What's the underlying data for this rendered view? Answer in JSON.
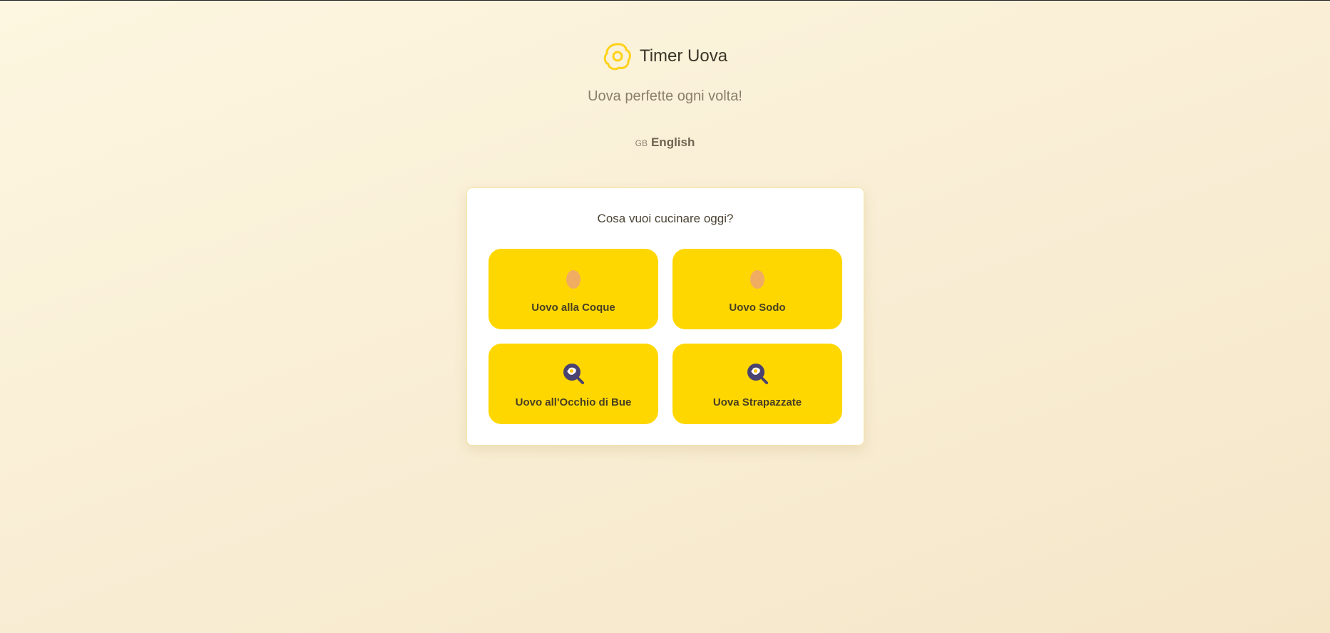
{
  "app": {
    "title": "Timer Uova",
    "subtitle": "Uova perfette ogni volta!",
    "logo_icon": "fried-egg-icon"
  },
  "language": {
    "flag_code": "GB",
    "label": "English"
  },
  "card": {
    "question": "Cosa vuoi cucinare oggi?",
    "options": [
      {
        "label": "Uovo alla Coque",
        "icon": "egg-icon"
      },
      {
        "label": "Uovo Sodo",
        "icon": "egg-icon"
      },
      {
        "label": "Uovo all'Occhio di Bue",
        "icon": "frying-pan-icon"
      },
      {
        "label": "Uova Strapazzate",
        "icon": "frying-pan-icon"
      }
    ]
  },
  "colors": {
    "accent": "#ffd700",
    "egg": "#f0ad62",
    "pan": "#4a4270"
  }
}
